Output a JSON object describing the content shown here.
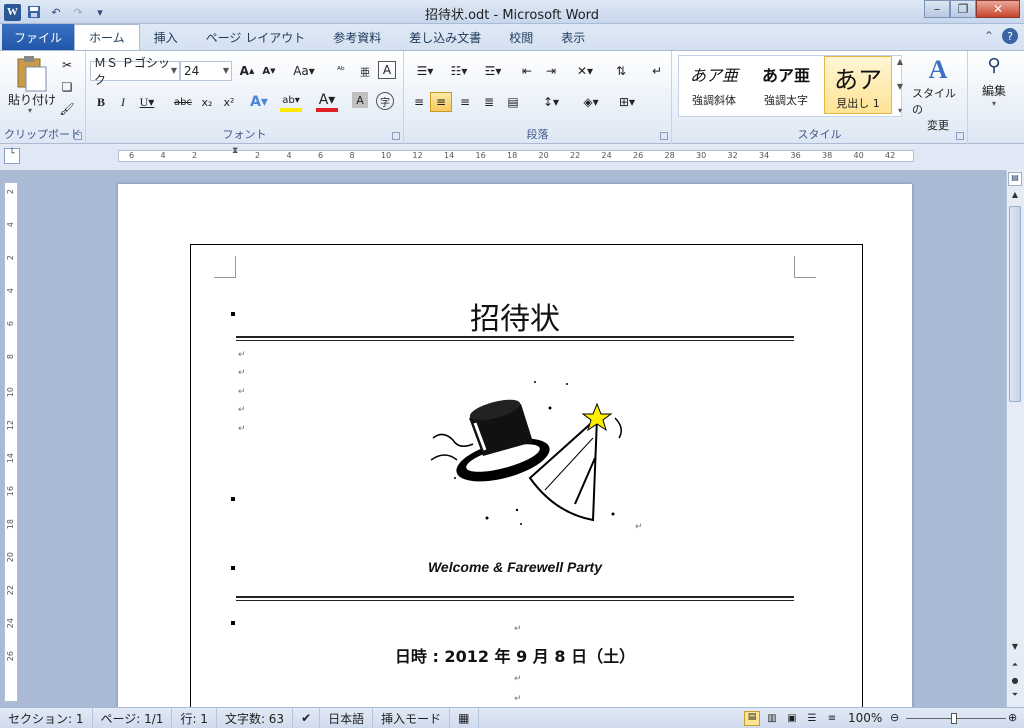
{
  "window": {
    "app_icon": "W",
    "title": "招待状.odt  -  Microsoft Word",
    "quick_access": [
      "save-icon",
      "undo-icon",
      "redo-icon",
      "customize-icon"
    ],
    "controls": [
      "minimize-icon",
      "maximize-icon",
      "close-icon"
    ]
  },
  "tabs": [
    {
      "label": "ファイル",
      "active": false
    },
    {
      "label": "ホーム",
      "active": true
    },
    {
      "label": "挿入",
      "active": false
    },
    {
      "label": "ページ レイアウト",
      "active": false
    },
    {
      "label": "参考資料",
      "active": false
    },
    {
      "label": "差し込み文書",
      "active": false
    },
    {
      "label": "校閲",
      "active": false
    },
    {
      "label": "表示",
      "active": false
    }
  ],
  "ribbon": {
    "clipboard": {
      "paste_label": "貼り付け",
      "group_label": "クリップボード"
    },
    "font": {
      "font_name": "ＭＳ Ｐゴシック",
      "font_size": "24",
      "group_label": "フォント"
    },
    "paragraph": {
      "group_label": "段落"
    },
    "styles": {
      "items": [
        {
          "sample": "あア亜",
          "label": "強調斜体",
          "selected": false
        },
        {
          "sample": "あア亜",
          "label": "強調太字",
          "selected": false
        },
        {
          "sample": "あア",
          "label": "見出し 1",
          "selected": true
        }
      ],
      "change_styles_label1": "スタイルの",
      "change_styles_label2": "変更",
      "group_label": "スタイル"
    },
    "editing": {
      "label": "編集"
    }
  },
  "ruler": {
    "h_ticks": [
      "6",
      "4",
      "2",
      "",
      "2",
      "4",
      "6",
      "8",
      "10",
      "12",
      "14",
      "16",
      "18",
      "20",
      "22",
      "24",
      "26",
      "28",
      "30",
      "32",
      "34",
      "36",
      "38",
      "40",
      "42"
    ],
    "v_ticks": [
      "2",
      "4",
      "2",
      "4",
      "6",
      "8",
      "10",
      "12",
      "14",
      "16",
      "18",
      "20",
      "22",
      "24",
      "26"
    ]
  },
  "document": {
    "title": "招待状",
    "party": "Welcome & Farewell Party",
    "datetime": "日時 : 2012 年 9 月 8 日（土）"
  },
  "status": {
    "section": "セクション: 1",
    "page": "ページ: 1/1",
    "line": "行: 1",
    "chars": "文字数: 63",
    "language": "日本語",
    "mode": "挿入モード",
    "zoom": "100%"
  },
  "colors": {
    "accent": "#2b5797",
    "file_tab": "#2a62b8",
    "highlight_yellow": "#ffe394"
  }
}
